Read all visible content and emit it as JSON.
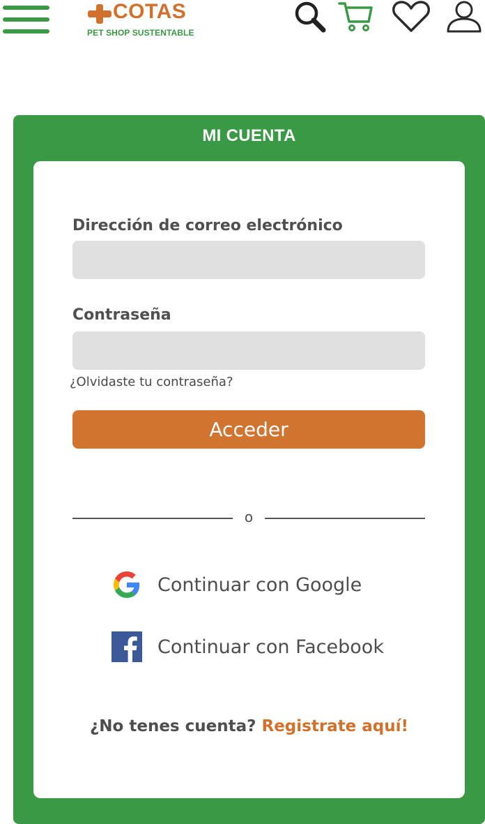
{
  "header": {
    "menu_icon": "hamburger-menu-icon",
    "logo": {
      "word": "COTAS",
      "tagline": "PET SHOP SUSTENTABLE"
    },
    "icons": [
      "search-icon",
      "cart-icon",
      "heart-icon",
      "user-icon"
    ],
    "colors": {
      "brand_green": "#3a9944",
      "brand_orange": "#d1712c"
    }
  },
  "card": {
    "title": "MI CUENTA",
    "email": {
      "label": "Dirección de correo electrónico",
      "value": "",
      "placeholder": ""
    },
    "password": {
      "label": "Contraseña",
      "value": "",
      "placeholder": ""
    },
    "forgot_link": "¿Olvidaste tu contraseña?",
    "submit_label": "Acceder",
    "divider_text": "o",
    "google": {
      "label": "Continuar con Google",
      "icon": "google-icon"
    },
    "facebook": {
      "label": "Continuar con Facebook",
      "icon": "facebook-icon"
    },
    "register": {
      "question": "¿No tenes cuenta?",
      "link": "Registrate aquí!"
    }
  }
}
